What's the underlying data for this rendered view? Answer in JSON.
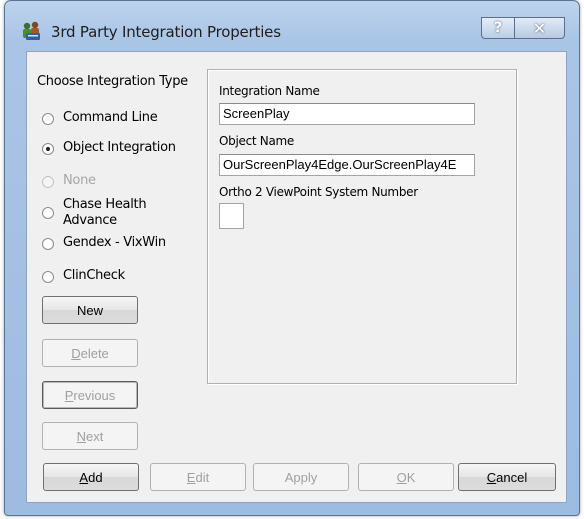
{
  "window": {
    "title": "3rd Party Integration Properties",
    "help_glyph": "?",
    "close_glyph": "✕"
  },
  "integration_type": {
    "group_label": "Choose Integration Type",
    "options": [
      {
        "label": "Command Line",
        "checked": false,
        "enabled": true
      },
      {
        "label": "Object Integration",
        "checked": true,
        "enabled": true
      },
      {
        "label": "None",
        "checked": false,
        "enabled": false
      },
      {
        "label": "Chase Health Advance",
        "checked": false,
        "enabled": true
      },
      {
        "label": "Gendex - VixWin",
        "checked": false,
        "enabled": true
      },
      {
        "label": "ClinCheck",
        "checked": false,
        "enabled": true
      }
    ],
    "chase_line1": "Chase Health",
    "chase_line2": "Advance"
  },
  "nav_buttons": {
    "new": "New",
    "delete_first": "D",
    "delete_rest": "elete",
    "previous_first": "P",
    "previous_rest": "revious",
    "next_first": "N",
    "next_rest": "ext"
  },
  "details": {
    "integration_name_label": "Integration Name",
    "integration_name_value": "ScreenPlay",
    "object_name_label": "Object Name",
    "object_name_value": "OurScreenPlay4Edge.OurScreenPlay4E",
    "viewpoint_label": "Ortho 2 ViewPoint System Number",
    "viewpoint_value": ""
  },
  "action_buttons": {
    "add_first": "A",
    "add_rest": "dd",
    "edit_first": "E",
    "edit_rest": "dit",
    "apply": "Apply",
    "ok_first": "O",
    "ok_rest": "K",
    "cancel_first": "C",
    "cancel_rest": "ancel"
  },
  "colors": {
    "frame": "#a9c5e6",
    "dialog_bg": "#f0f0f0",
    "disabled_text": "#a0a0a0"
  }
}
